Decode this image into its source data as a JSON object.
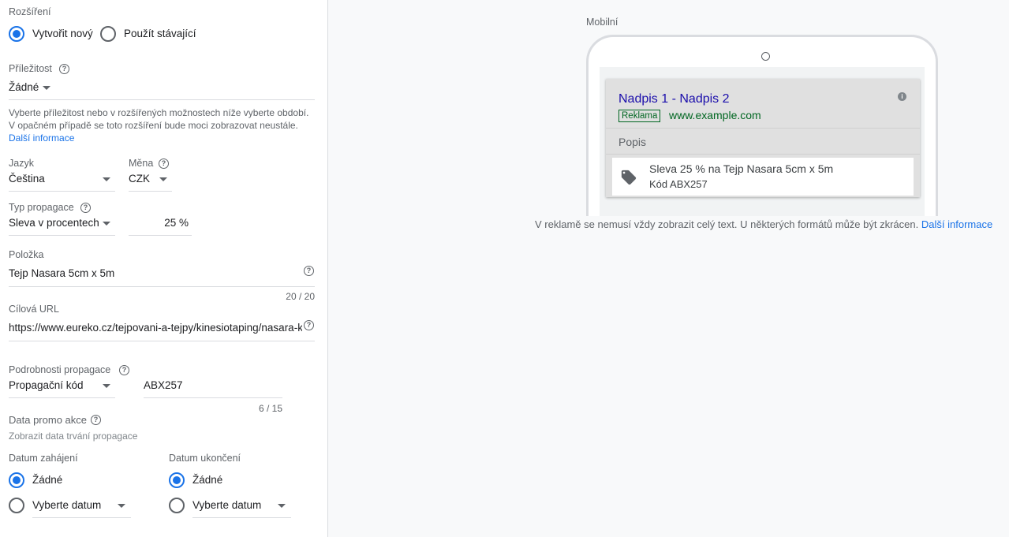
{
  "extension": {
    "label": "Rozšíření",
    "opt_new": "Vytvořit nový",
    "opt_existing": "Použít stávající"
  },
  "occasion": {
    "label": "Příležitost",
    "value": "Žádné",
    "help1": "Vyberte příležitost nebo v rozšířených možnostech níže vyberte období.",
    "help2": "V opačném případě se toto rozšíření bude moci zobrazovat neustále.",
    "more": "Další informace"
  },
  "language": {
    "label": "Jazyk",
    "value": "Čeština"
  },
  "currency": {
    "label": "Měna",
    "value": "CZK"
  },
  "promo_type": {
    "label": "Typ propagace",
    "value": "Sleva v procentech",
    "amount": "25 %"
  },
  "item": {
    "label": "Položka",
    "value": "Tejp Nasara 5cm x 5m",
    "counter": "20 / 20"
  },
  "url": {
    "label": "Cílová URL",
    "value": "https://www.eureko.cz/tejpovani-a-tejpy/kinesiotaping/nasara-kin"
  },
  "promo_details": {
    "label": "Podrobnosti propagace",
    "type": "Propagační kód",
    "code": "ABX257",
    "counter": "6 / 15"
  },
  "promo_dates": {
    "label": "Data promo akce",
    "sub": "Zobrazit data trvání propagace",
    "start_label": "Datum zahájení",
    "end_label": "Datum ukončení",
    "none": "Žádné",
    "pick": "Vyberte datum"
  },
  "preview": {
    "device": "Mobilní",
    "headline": "Nadpis 1 - Nadpis 2",
    "badge": "Reklama",
    "display_url": "www.example.com",
    "description": "Popis",
    "promo_line": "Sleva 25 % na Tejp Nasara 5cm x 5m",
    "promo_code": "Kód ABX257",
    "disclaimer": "V reklamě se nemusí vždy zobrazit celý text. U některých formátů může být zkrácen.",
    "more": "Další informace"
  },
  "colors": {
    "accent": "#1a73e8",
    "ad_link": "#1a0dab",
    "ad_url": "#006621"
  }
}
